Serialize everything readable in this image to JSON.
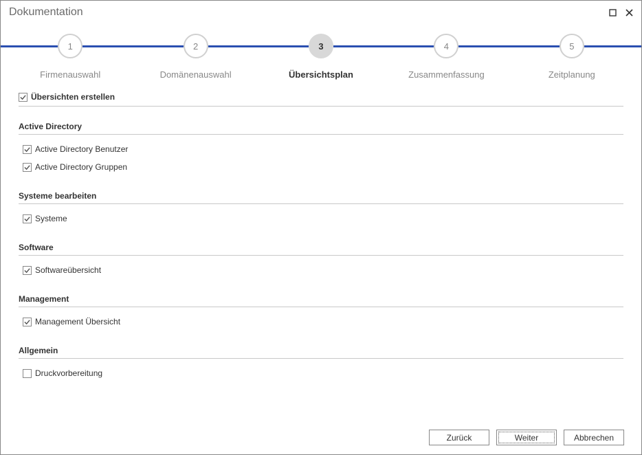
{
  "window": {
    "title": "Dokumentation"
  },
  "stepper": {
    "steps": [
      {
        "num": "1",
        "label": "Firmenauswahl"
      },
      {
        "num": "2",
        "label": "Domänenauswahl"
      },
      {
        "num": "3",
        "label": "Übersichtsplan"
      },
      {
        "num": "4",
        "label": "Zusammenfassung"
      },
      {
        "num": "5",
        "label": "Zeitplanung"
      }
    ],
    "active_index": 2
  },
  "master": {
    "label": "Übersichten erstellen",
    "checked": true
  },
  "sections": [
    {
      "title": "Active Directory",
      "items": [
        {
          "label": "Active Directory Benutzer",
          "checked": true
        },
        {
          "label": "Active Directory Gruppen",
          "checked": true
        }
      ]
    },
    {
      "title": "Systeme bearbeiten",
      "items": [
        {
          "label": "Systeme",
          "checked": true
        }
      ]
    },
    {
      "title": "Software",
      "items": [
        {
          "label": "Softwareübersicht",
          "checked": true
        }
      ]
    },
    {
      "title": "Management",
      "items": [
        {
          "label": "Management Übersicht",
          "checked": true
        }
      ]
    },
    {
      "title": "Allgemein",
      "items": [
        {
          "label": "Druckvorbereitung",
          "checked": false
        }
      ]
    }
  ],
  "buttons": {
    "back": "Zurück",
    "next": "Weiter",
    "cancel": "Abbrechen"
  }
}
